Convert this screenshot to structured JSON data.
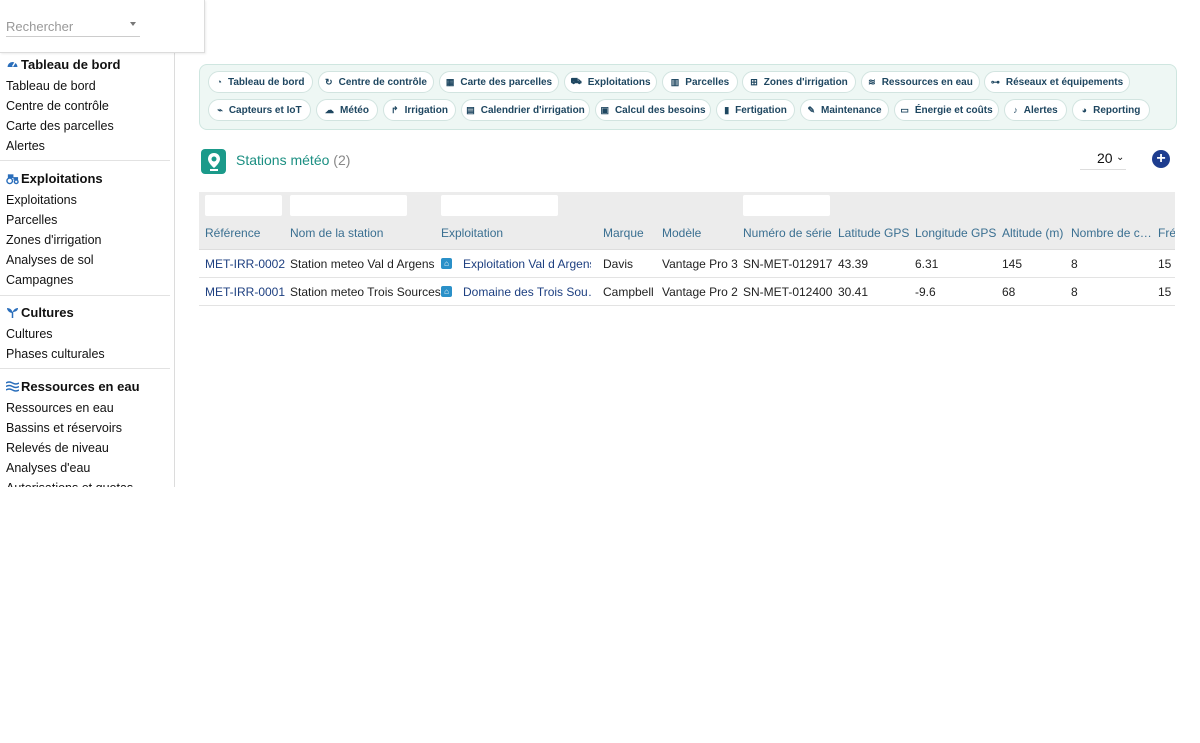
{
  "search": {
    "placeholder": "Rechercher"
  },
  "sidebar": {
    "sections": [
      {
        "title": "Tableau de bord",
        "icon": "gauge-icon",
        "items": [
          "Tableau de bord",
          "Centre de contrôle",
          "Carte des parcelles",
          "Alertes"
        ]
      },
      {
        "title": "Exploitations",
        "icon": "tractor-icon",
        "items": [
          "Exploitations",
          "Parcelles",
          "Zones d'irrigation",
          "Analyses de sol",
          "Campagnes"
        ]
      },
      {
        "title": "Cultures",
        "icon": "sprout-icon",
        "items": [
          "Cultures",
          "Phases culturales"
        ]
      },
      {
        "title": "Ressources en eau",
        "icon": "water-waves-icon",
        "items": [
          "Ressources en eau",
          "Bassins et réservoirs",
          "Relevés de niveau",
          "Analyses d'eau",
          "Autorisations et quotas"
        ]
      }
    ]
  },
  "menu": {
    "row1": [
      {
        "label": "Tableau de bord",
        "icon": "gauge-icon"
      },
      {
        "label": "Centre de contrôle",
        "icon": "refresh-icon"
      },
      {
        "label": "Carte des parcelles",
        "icon": "map-grid-icon"
      },
      {
        "label": "Exploitations",
        "icon": "tractor-icon"
      },
      {
        "label": "Parcelles",
        "icon": "map-icon"
      },
      {
        "label": "Zones d'irrigation",
        "icon": "sitemap-icon"
      },
      {
        "label": "Ressources en eau",
        "icon": "water-icon"
      },
      {
        "label": "Réseaux et équipements",
        "icon": "network-icon"
      }
    ],
    "row2": [
      {
        "label": "Capteurs et IoT",
        "icon": "antenna-icon"
      },
      {
        "label": "Météo",
        "icon": "cloud-sun-icon"
      },
      {
        "label": "Irrigation",
        "icon": "faucet-icon"
      },
      {
        "label": "Calendrier d'irrigation",
        "icon": "calendar-icon"
      },
      {
        "label": "Calcul des besoins",
        "icon": "calculator-icon"
      },
      {
        "label": "Fertigation",
        "icon": "flask-icon"
      },
      {
        "label": "Maintenance",
        "icon": "wrench-icon"
      },
      {
        "label": "Énergie et coûts",
        "icon": "money-icon"
      },
      {
        "label": "Alertes",
        "icon": "bell-icon"
      },
      {
        "label": "Reporting",
        "icon": "pie-chart-icon"
      }
    ]
  },
  "list": {
    "title": "Stations météo",
    "count": "(2)",
    "page_size": "20",
    "columns": [
      "Référence",
      "Nom de la station",
      "Exploitation",
      "Marque",
      "Modèle",
      "Numéro de série",
      "Latitude GPS",
      "Longitude GPS",
      "Altitude (m)",
      "Nombre de c…",
      "Fré…"
    ],
    "rows": [
      [
        "MET-IRR-0002",
        "Station meteo Val d Argens",
        "Exploitation Val d Argens",
        "Davis",
        "Vantage Pro 3",
        "SN-MET-012917",
        "43.39",
        "6.31",
        "145",
        "8",
        "15"
      ],
      [
        "MET-IRR-0001",
        "Station meteo Trois Sources",
        "Domaine des Trois Sou…",
        "Campbell",
        "Vantage Pro 2",
        "SN-MET-012400",
        "30.41",
        "-9.6",
        "68",
        "8",
        "15"
      ]
    ]
  },
  "colors": {
    "accent": "#1b8f82",
    "link": "#1d3f80",
    "header_text": "#3a6f91",
    "add_button": "#1e3d8f"
  }
}
